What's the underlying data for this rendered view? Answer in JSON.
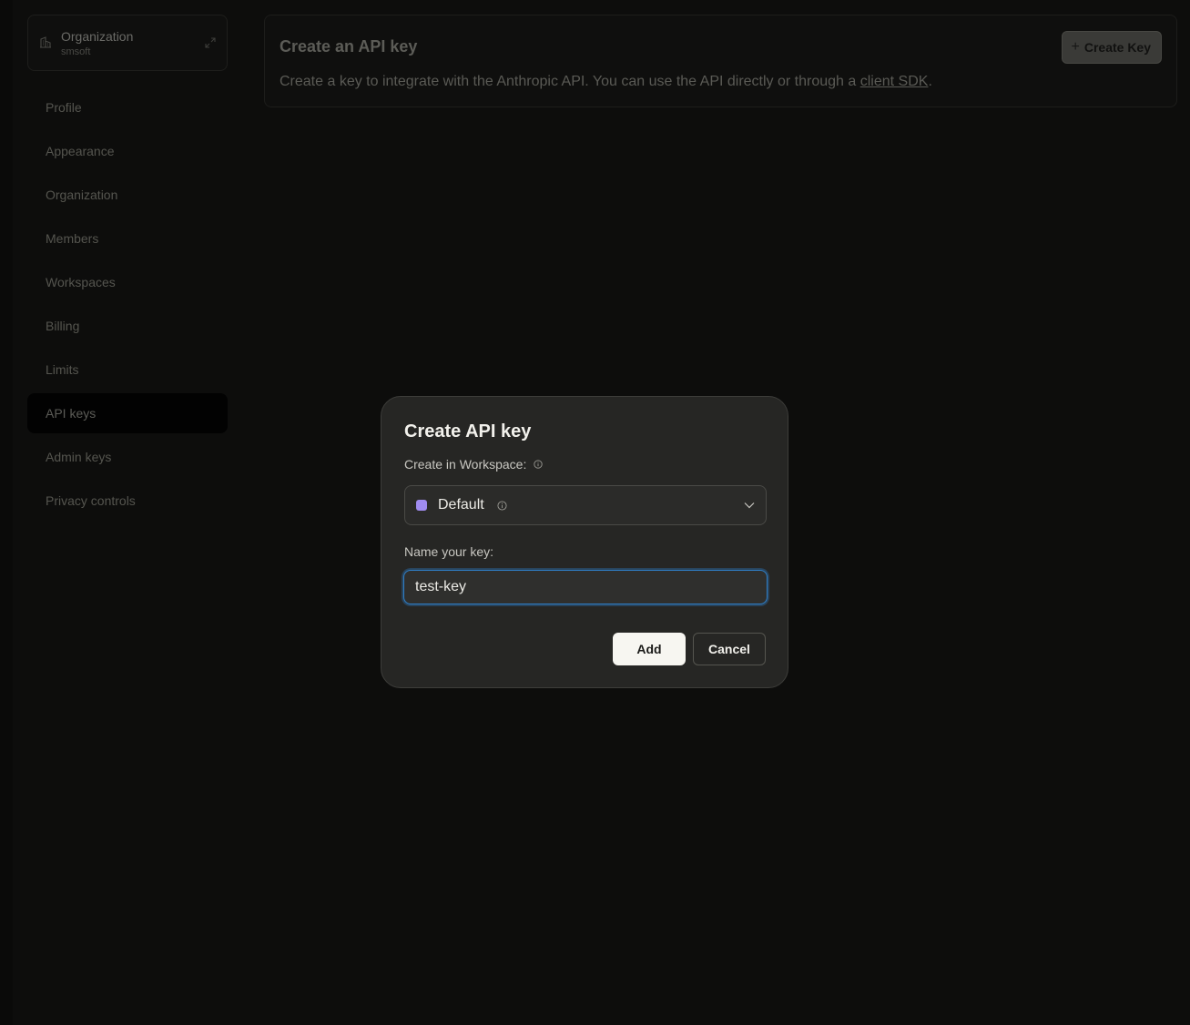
{
  "org": {
    "name": "Organization",
    "subtitle": "smsoft",
    "icon": "building-icon",
    "expand_icon": "expand-icon"
  },
  "sidebar": {
    "items": [
      {
        "label": "Profile",
        "active": false
      },
      {
        "label": "Appearance",
        "active": false
      },
      {
        "label": "Organization",
        "active": false
      },
      {
        "label": "Members",
        "active": false
      },
      {
        "label": "Workspaces",
        "active": false
      },
      {
        "label": "Billing",
        "active": false
      },
      {
        "label": "Limits",
        "active": false
      },
      {
        "label": "API keys",
        "active": true
      },
      {
        "label": "Admin keys",
        "active": false
      },
      {
        "label": "Privacy controls",
        "active": false
      }
    ]
  },
  "main": {
    "title": "Create an API key",
    "description_before": "Create a key to integrate with the Anthropic API. You can use the API directly or through a ",
    "description_link": "client SDK",
    "description_after": ".",
    "create_button_label": "Create Key",
    "create_button_icon": "plus-icon"
  },
  "modal": {
    "title": "Create API key",
    "workspace_label": "Create in Workspace:",
    "workspace_value": "Default",
    "workspace_color": "#a08cf0",
    "name_label": "Name your key:",
    "name_value": "test-key",
    "add_label": "Add",
    "cancel_label": "Cancel"
  },
  "colors": {
    "background": "#0d0d0c",
    "modal_background": "#262624",
    "focus_ring": "#2f7fc8",
    "primary_button": "#f7f6f1"
  }
}
